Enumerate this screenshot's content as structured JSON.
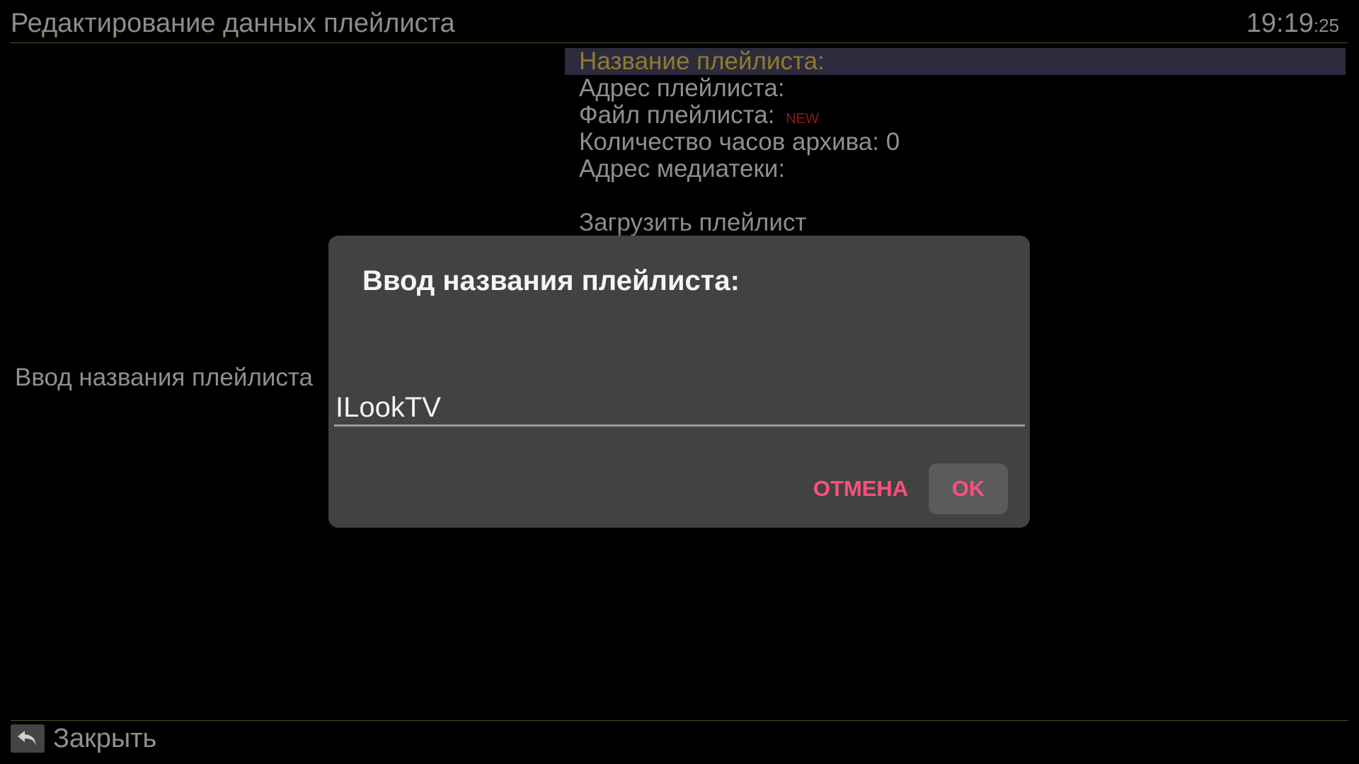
{
  "header": {
    "title": "Редактирование данных плейлиста",
    "clock_hm": "19:19",
    "clock_sec": ":25"
  },
  "menu": {
    "items": [
      {
        "label": "Название плейлиста:"
      },
      {
        "label": "Адрес плейлиста:"
      },
      {
        "label": "Файл плейлиста:",
        "badge": "NEW"
      },
      {
        "label": "Количество часов архива: 0"
      },
      {
        "label": "Адрес медиатеки:"
      },
      {
        "label": "Загрузить плейлист"
      }
    ],
    "selected_index": 0
  },
  "side_label": "Ввод названия плейлиста",
  "dialog": {
    "title": "Ввод названия плейлиста:",
    "input_value": "ILookTV",
    "cancel_label": "ОТМЕНА",
    "ok_label": "OK"
  },
  "footer": {
    "close_label": "Закрыть",
    "close_icon": "back-arrow-icon"
  },
  "colors": {
    "background": "#000000",
    "text_dim": "#8f8f8f",
    "selected_text": "#8f7b2e",
    "selected_bg": "#2b2b3d",
    "dialog_bg": "#424242",
    "dialog_accent": "#ff4f7e",
    "new_badge": "#8c1a1a"
  }
}
